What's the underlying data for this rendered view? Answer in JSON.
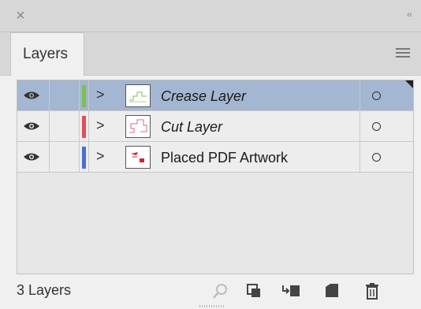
{
  "window": {
    "close_glyph": "×",
    "collapse_glyph": "‹‹"
  },
  "tabs": [
    {
      "label": "Layers",
      "active": true
    }
  ],
  "panel_menu_icon": "hamburger-menu-icon",
  "layers": [
    {
      "name": "Crease Layer",
      "italic": true,
      "selected": true,
      "color": "#7cc04a",
      "visible": true,
      "expand_glyph": ">",
      "target": "○",
      "thumbnail": "crease-thumbnail"
    },
    {
      "name": "Cut Layer",
      "italic": true,
      "selected": false,
      "color": "#e04f5a",
      "visible": true,
      "expand_glyph": ">",
      "target": "○",
      "thumbnail": "cut-thumbnail"
    },
    {
      "name": "Placed PDF Artwork",
      "italic": false,
      "selected": false,
      "color": "#4a6fd0",
      "visible": true,
      "expand_glyph": ">",
      "target": "○",
      "thumbnail": "pdf-thumbnail"
    }
  ],
  "footer": {
    "count_label": "3 Layers",
    "icons": [
      "search-icon",
      "clipping-mask-icon",
      "new-sublayer-icon",
      "new-layer-icon",
      "delete-icon"
    ]
  },
  "colors": {
    "selection": "#a3b6d2",
    "panel_bg": "#e7e7e7",
    "titlebar": "#d7d7d7"
  }
}
